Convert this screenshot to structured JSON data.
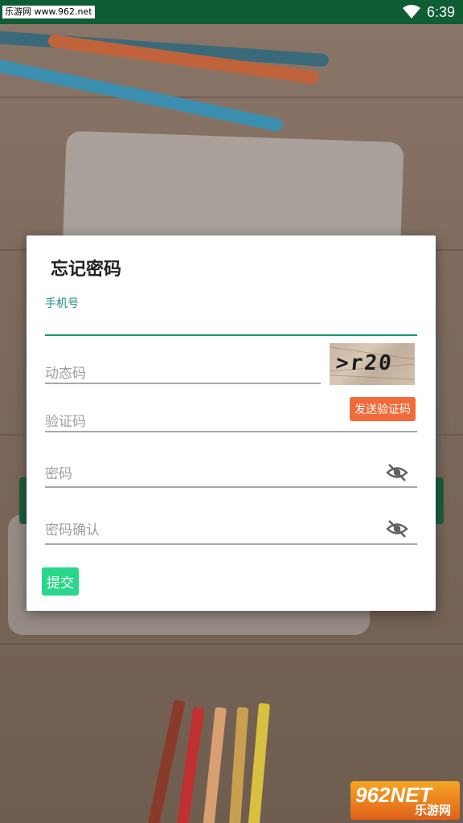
{
  "status_bar": {
    "watermark": "乐游网 www.962.net",
    "time": "6:39"
  },
  "dialog": {
    "title": "忘记密码",
    "phone_label": "手机号",
    "dynamic_code_placeholder": "动态码",
    "captcha_text": ">r20",
    "verify_code_placeholder": "验证码",
    "send_code_label": "发送验证码",
    "password_placeholder": "密码",
    "confirm_password_placeholder": "密码确认",
    "submit_label": "提交"
  },
  "brand": {
    "logo_text": "962NET",
    "logo_sub": "乐游网"
  },
  "colors": {
    "status_bar": "#0e5d35",
    "accent": "#1a8f7e",
    "send_button": "#f26a3a",
    "submit_button": "#2ad68a"
  }
}
